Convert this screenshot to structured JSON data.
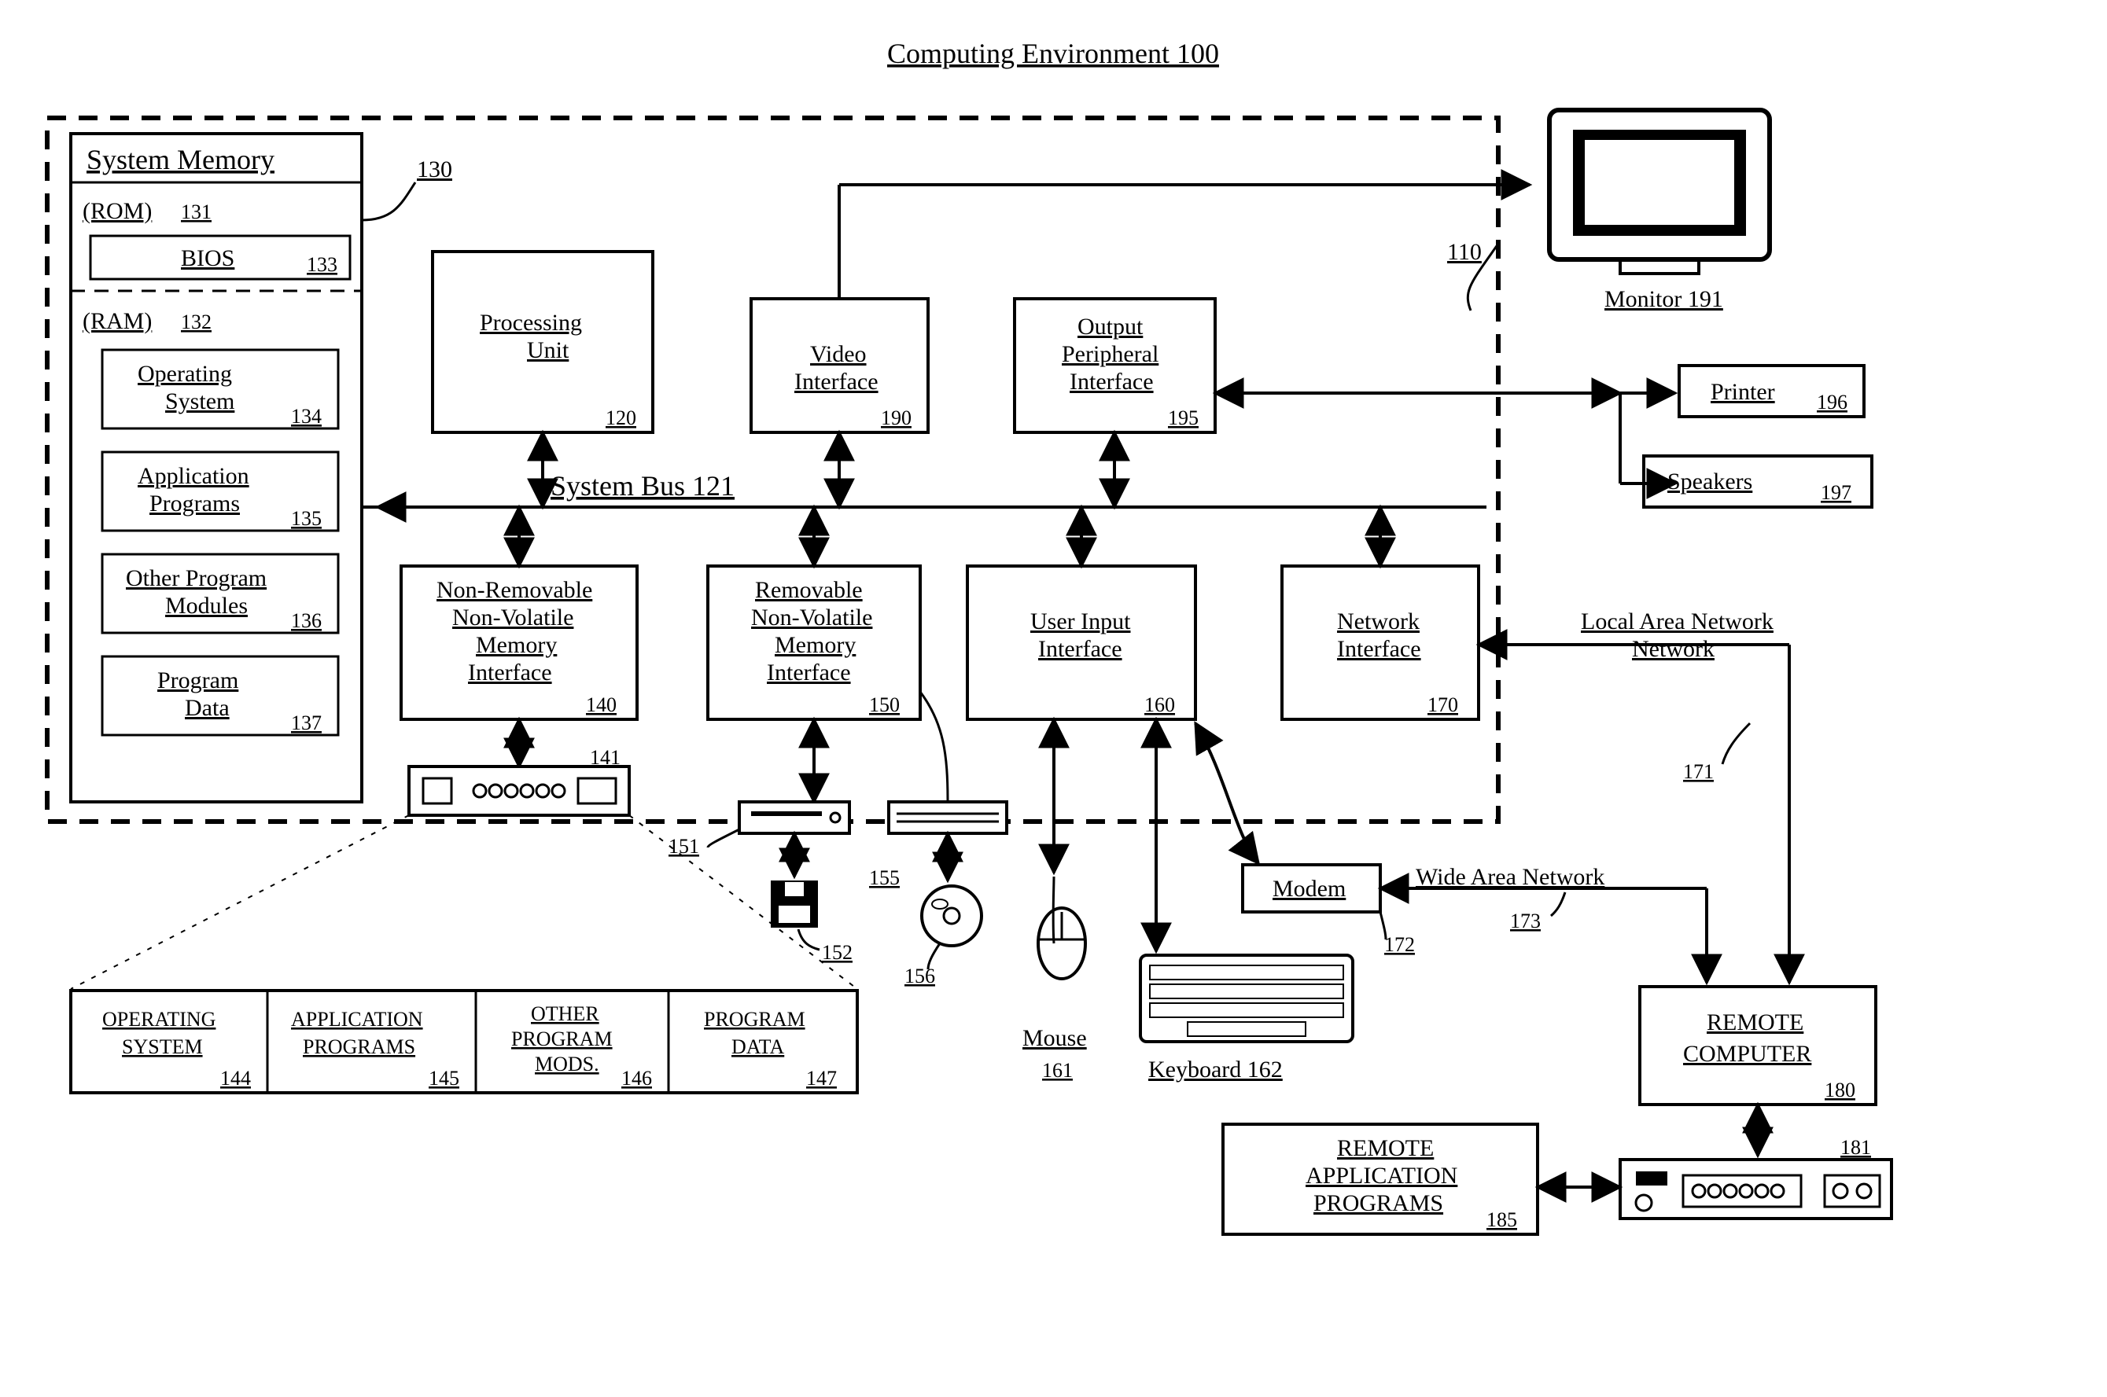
{
  "title": "Computing Environment 100",
  "sysmem": {
    "header": "System Memory",
    "rom": "(ROM)",
    "rom_num": "131",
    "bios": "BIOS",
    "bios_num": "133",
    "ram": "(RAM)",
    "ram_num": "132",
    "os": "Operating System",
    "os_num": "134",
    "apps": "Application Programs",
    "apps_num": "135",
    "mods": "Other Program Modules",
    "mods_num": "136",
    "pdata": "Program Data",
    "pdata_num": "137",
    "lead_num": "130"
  },
  "computer_num": "110",
  "bus": "System Bus 121",
  "pu": {
    "label": "Processing Unit",
    "num": "120"
  },
  "video": {
    "label": "Video Interface",
    "num": "190"
  },
  "output": {
    "l1": "Output",
    "l2": "Peripheral",
    "l3": "Interface",
    "num": "195"
  },
  "nrnv": {
    "l1": "Non-Removable",
    "l2": "Non-Volatile",
    "l3": "Memory",
    "l4": "Interface",
    "num": "140"
  },
  "rnv": {
    "l1": "Removable",
    "l2": "Non-Volatile",
    "l3": "Memory",
    "l4": "Interface",
    "num": "150"
  },
  "uinput": {
    "l1": "User Input",
    "l2": "Interface",
    "num": "160"
  },
  "net": {
    "l1": "Network",
    "l2": "Interface",
    "num": "170"
  },
  "hdd_num": "141",
  "fdd_num": "151",
  "floppy_num": "152",
  "odd_num": "155",
  "disc_num": "156",
  "mouse": {
    "label": "Mouse",
    "num": "161"
  },
  "keyboard": {
    "label": "Keyboard 162"
  },
  "modem": {
    "label": "Modem",
    "num": "172"
  },
  "lan": {
    "label": "Local Area Network",
    "num": "171"
  },
  "wan": {
    "label": "Wide Area Network",
    "num": "173"
  },
  "monitor": {
    "label": "Monitor 191"
  },
  "printer": {
    "label": "Printer",
    "num": "196"
  },
  "speakers": {
    "label": "Speakers",
    "num": "197"
  },
  "remote": {
    "label": "REMOTE COMPUTER",
    "num": "180"
  },
  "remote_hdd_num": "181",
  "rap": {
    "l1": "REMOTE",
    "l2": "APPLICATION",
    "l3": "PROGRAMS",
    "num": "185"
  },
  "disk": {
    "os": "OPERATING SYSTEM",
    "os_num": "144",
    "apps": "APPLICATION PROGRAMS",
    "apps_num": "145",
    "mods_l1": "OTHER",
    "mods_l2": "PROGRAM",
    "mods_l3": "MODS.",
    "mods_num": "146",
    "pdata": "PROGRAM DATA",
    "pdata_num": "147"
  }
}
